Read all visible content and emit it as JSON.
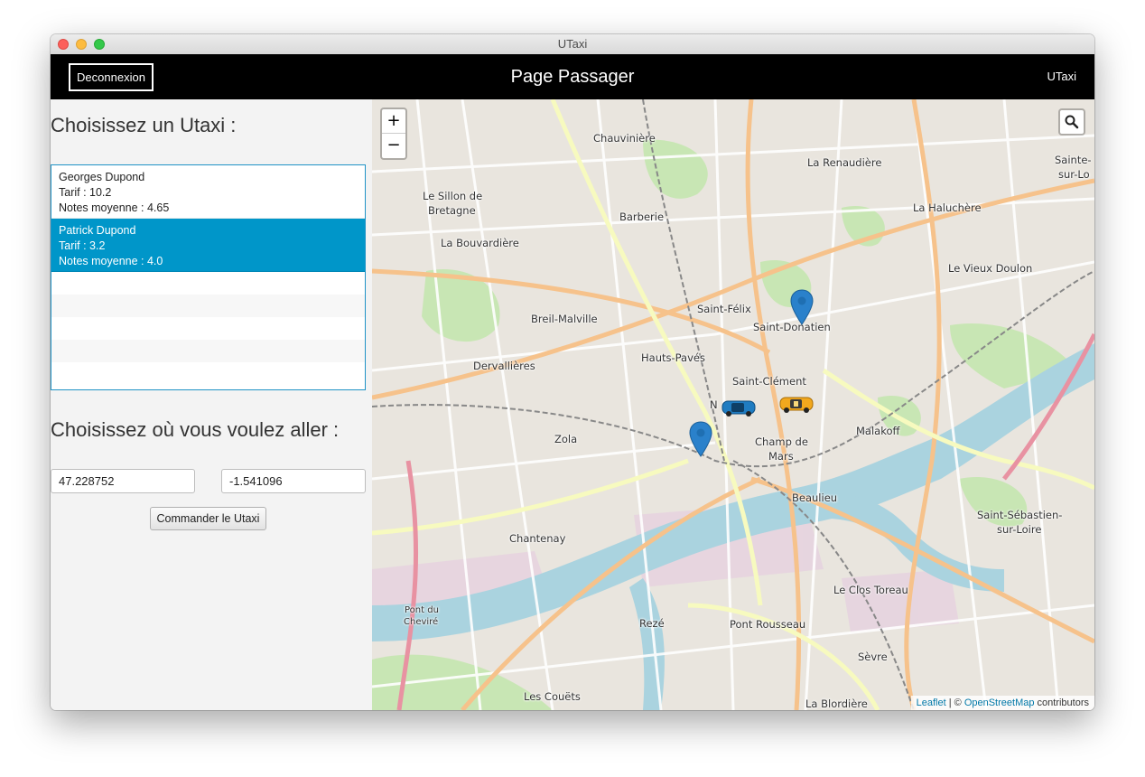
{
  "window": {
    "title": "UTaxi"
  },
  "appbar": {
    "logout_label": "Deconnexion",
    "page_title": "Page Passager",
    "brand": "UTaxi"
  },
  "drivers_section": {
    "heading": "Choisissez un Utaxi :"
  },
  "drivers": [
    {
      "name": "Georges Dupond",
      "tarif": "Tarif : 10.2",
      "note": "Notes moyenne : 4.65",
      "selected": false
    },
    {
      "name": "Patrick Dupond",
      "tarif": "Tarif : 3.2",
      "note": "Notes moyenne : 4.0",
      "selected": true
    }
  ],
  "destination_section": {
    "heading": "Choisissez où vous voulez aller :",
    "latitude": "47.228752",
    "longitude": "-1.541096",
    "order_label": "Commander le Utaxi"
  },
  "map": {
    "zoom_in": "+",
    "zoom_out": "−",
    "attribution": {
      "leaflet": "Leaflet",
      "sep": " | © ",
      "osm": "OpenStreetMap",
      "suffix": " contributors"
    },
    "places": [
      "Chauvinière",
      "La Renaudière",
      "Le Sillon de",
      "Bretagne",
      "Barberie",
      "La Haluchère",
      "La Bouvardière",
      "Le Vieux Doulon",
      "Saint-Félix",
      "Saint-Donatien",
      "Breil-Malville",
      "Hauts-Pavés",
      "Dervallières",
      "Saint-Clément",
      "N",
      "Malakoff",
      "Zola",
      "Champ de",
      "Mars",
      "Beaulieu",
      "Saint-Sébastien-",
      "sur-Loire",
      "Chantenay",
      "Le Clos Toreau",
      "Pont du",
      "Cheviré",
      "Rezé",
      "Pont Rousseau",
      "Sèvre",
      "Les Couëts",
      "La Blordière",
      "Sainte-",
      "sur-Lo"
    ],
    "colors": {
      "water": "#aad3df",
      "park": "#c8e6b4",
      "primary": "#f6c28b",
      "secondary": "#f7fabf",
      "rail": "#888888"
    }
  }
}
